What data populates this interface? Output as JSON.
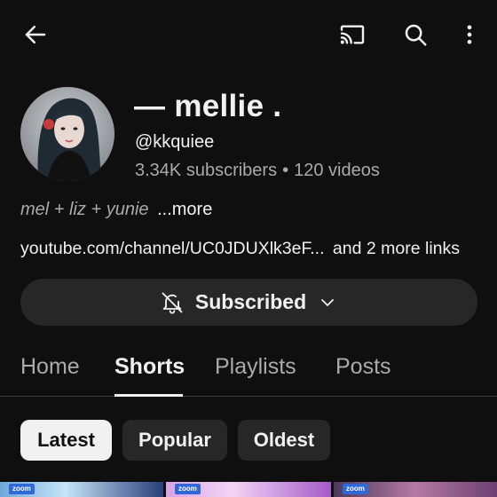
{
  "channel": {
    "name": "— mellie .",
    "handle": "@kkquiee",
    "subscribers": "3.34K subscribers",
    "separator": "•",
    "videos": "120 videos",
    "description": "mel + liz + yunie",
    "description_more": "...more",
    "link_url": "youtube.com/channel/UC0JDUXlk3eF...",
    "link_extra": "and 2 more links"
  },
  "subscribe": {
    "label": "Subscribed"
  },
  "tabs": [
    {
      "label": "Home",
      "active": false
    },
    {
      "label": "Shorts",
      "active": true
    },
    {
      "label": "Playlists",
      "active": false
    },
    {
      "label": "Posts",
      "active": false
    }
  ],
  "chips": [
    {
      "label": "Latest",
      "selected": true
    },
    {
      "label": "Popular",
      "selected": false
    },
    {
      "label": "Oldest",
      "selected": false
    }
  ],
  "thumbnails": [
    {
      "badge": "zoom"
    },
    {
      "badge": "zoom"
    },
    {
      "badge": "zoom"
    }
  ],
  "colors": {
    "background": "#0f0f0f",
    "primary_text": "#f1f1f1",
    "secondary_text": "#aaaaaa",
    "button_bg": "#272727"
  },
  "icons": {
    "back": "arrow-left-icon",
    "cast": "cast-icon",
    "search": "search-icon",
    "more": "more-vertical-icon",
    "bell": "bell-off-icon",
    "dropdown": "chevron-down-icon"
  }
}
